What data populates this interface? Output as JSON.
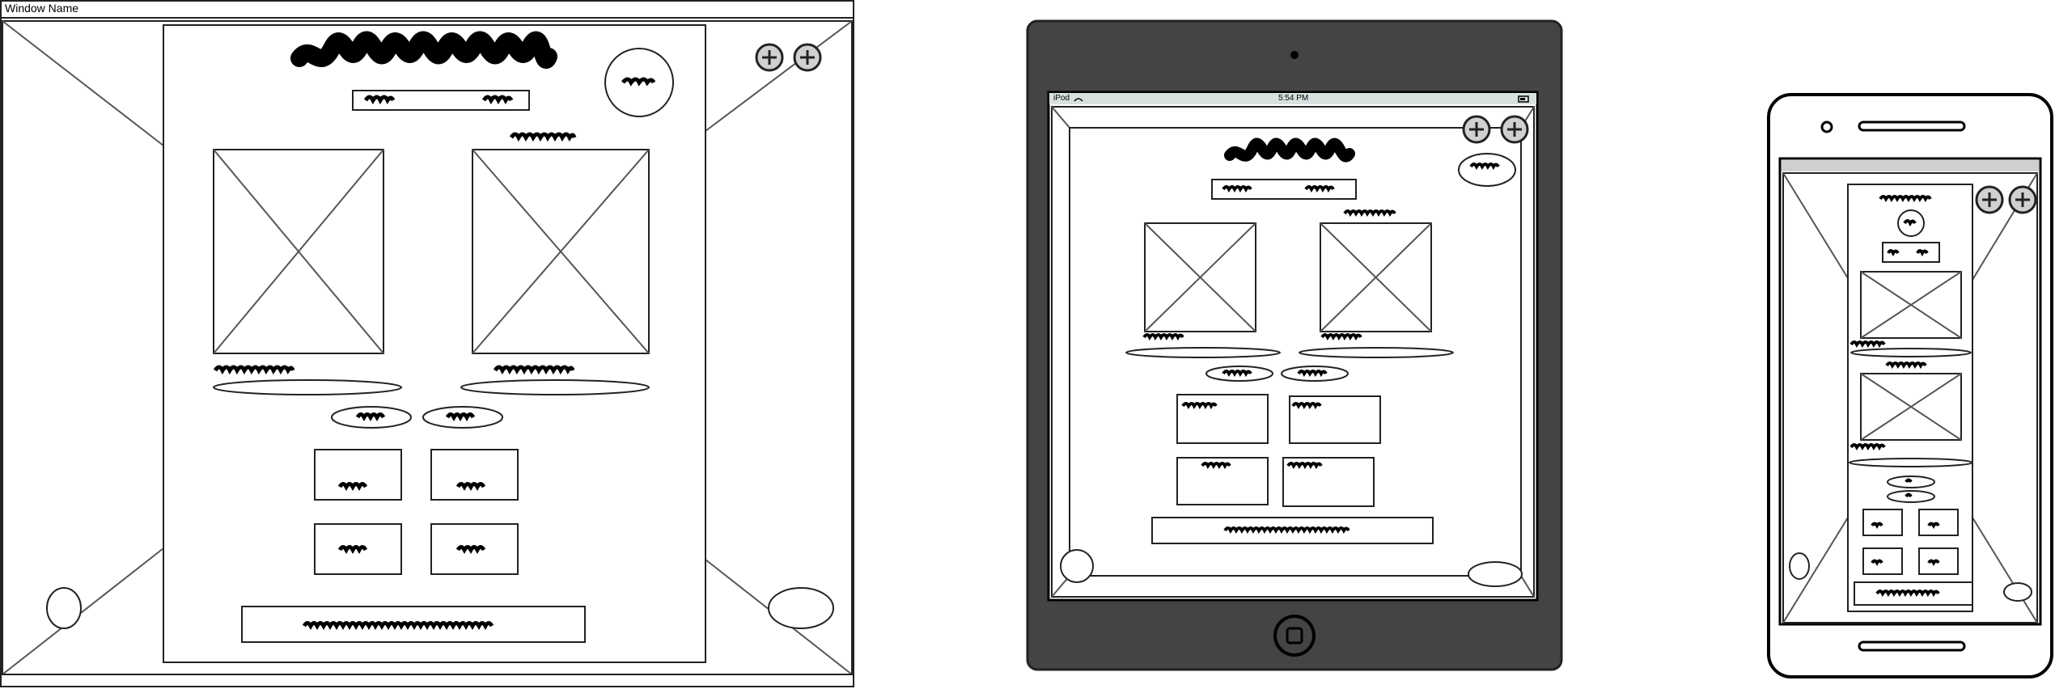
{
  "desktop": {
    "window_title": "Window Name"
  },
  "tablet": {
    "carrier": "iPod",
    "time": "5:54 PM"
  },
  "icons": {
    "add": "add-circle-icon",
    "image": "image-placeholder-icon",
    "home": "home-button-icon"
  }
}
